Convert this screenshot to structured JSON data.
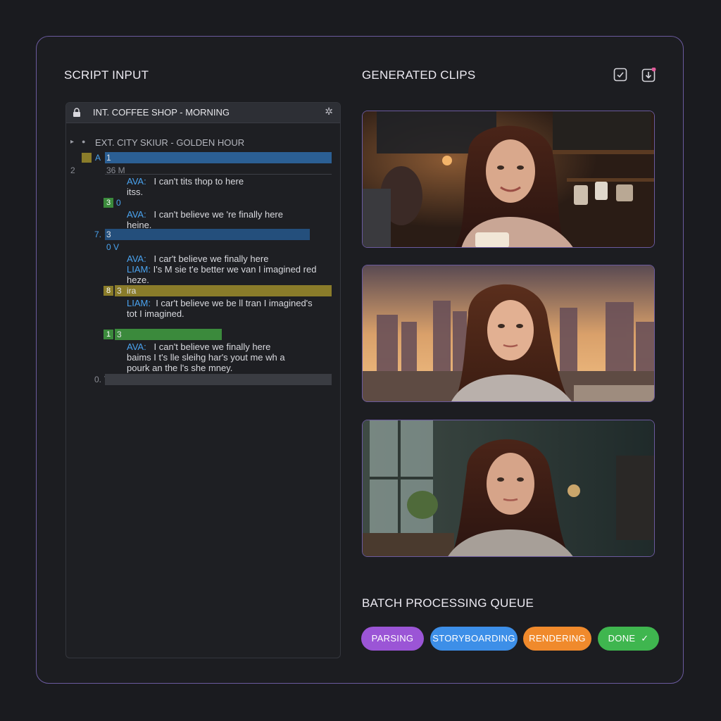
{
  "script_panel": {
    "title": "SCRIPT INPUT",
    "header_scene": "INT. COFFEE SHOP - MORNING",
    "scene2": "EXT. CITY SKIUR - GOLDEN HOUR",
    "lines": {
      "n_a": "A",
      "n_1": "1",
      "n_2": "2",
      "n_36m": "36 M",
      "d1_speaker": "AVA:",
      "d1_text": "I can't tits thop to here",
      "d1_cont": "itss.",
      "n_3a": "3",
      "n_0": "0",
      "d2_speaker": "AVA:",
      "d2_text": "I can't believe we  're finally here",
      "d2_cont": "heine.",
      "n_7": "7.",
      "n_3b": "3",
      "n_0v": "0  V",
      "d3_speaker": "AVA:",
      "d3_text": "I car't believe we finally here",
      "d4_speaker": "LIAM:",
      "d4_text": "I's M sie t'e better we van I imagined red",
      "d4_cont": "heze.",
      "n_8": "8",
      "n_3c": "3",
      "n_ira": "ira",
      "d5_speaker": "LIAM:",
      "d5_text": "I car't believe we be ll tran I imagined's",
      "d5_cont": "tot I imagined.",
      "n_1b": "1",
      "n_3d": "3",
      "d6_speaker": "AVA:",
      "d6_text": "I can't believe we finally here",
      "d6_line2": "baims  I t's lle sleihg har's yout me wh a",
      "d6_line3": "pourk an the l's she mney.",
      "n_07": "0. 7"
    }
  },
  "clips_panel": {
    "title": "GENERATED CLIPS",
    "icons": [
      "check-square-icon",
      "download-icon"
    ]
  },
  "queue": {
    "title": "BATCH PROCESSING QUEUE",
    "stages": [
      {
        "label": "PARSING",
        "color": "#9b55d6"
      },
      {
        "label": "STORYBOARDING",
        "color": "#3d8fe8"
      },
      {
        "label": "RENDERING",
        "color": "#f08a2c"
      },
      {
        "label": "DONE",
        "color": "#3fb64f"
      }
    ]
  },
  "colors": {
    "accent_border": "#6b5a9e",
    "speaker": "#4aa3ef",
    "highlight_blue": "#2b5f94",
    "highlight_olive": "#8a7c2a",
    "highlight_green": "#3b8a3c"
  }
}
